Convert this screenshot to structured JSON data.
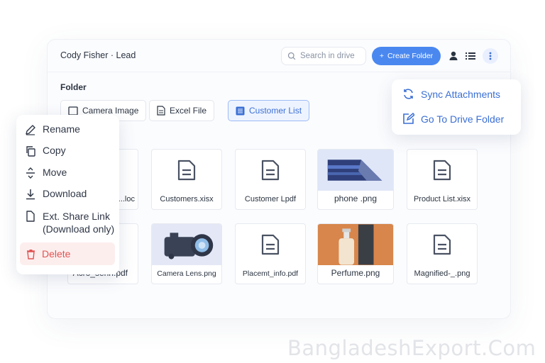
{
  "header": {
    "user_title": "Cody Fisher · Lead",
    "search_placeholder": "Search in drive",
    "create_folder_label": "Create Folder"
  },
  "folder_label": "Folder",
  "chips": [
    {
      "label": "Camera Image",
      "icon": "image-icon"
    },
    {
      "label": "Excel File",
      "icon": "document-icon"
    },
    {
      "label": "Customer List",
      "icon": "table-icon",
      "active": true
    }
  ],
  "files_row1": [
    {
      "name": "...loc",
      "icon": "document-icon"
    },
    {
      "name": "Customers.xisx",
      "icon": "document-icon"
    },
    {
      "name": "Customer Lpdf",
      "icon": "document-icon"
    },
    {
      "name": "phone .png",
      "icon": "phone-image"
    },
    {
      "name": "Product List.xisx",
      "icon": "document-icon"
    }
  ],
  "files_row2": [
    {
      "name": "Acro_senn.pdf",
      "icon": "document-icon"
    },
    {
      "name": "Camera Lens.png",
      "icon": "camera-image"
    },
    {
      "name": "Placemt_info.pdf",
      "icon": "document-icon"
    },
    {
      "name": "Perfume.png",
      "icon": "perfume-image"
    },
    {
      "name": "Magnified-_.png",
      "icon": "document-icon"
    }
  ],
  "context_menu": {
    "rename": "Rename",
    "copy": "Copy",
    "move": "Move",
    "download": "Download",
    "share_line1": "Ext. Share Link",
    "share_line2": "(Download only)",
    "delete": "Delete"
  },
  "right_menu": {
    "sync": "Sync Attachments",
    "goto": "Go To Drive Folder"
  },
  "watermark": "BangladeshExport.Com",
  "colors": {
    "accent": "#4a88f0",
    "danger": "#e05454",
    "link": "#3b6fd4"
  }
}
